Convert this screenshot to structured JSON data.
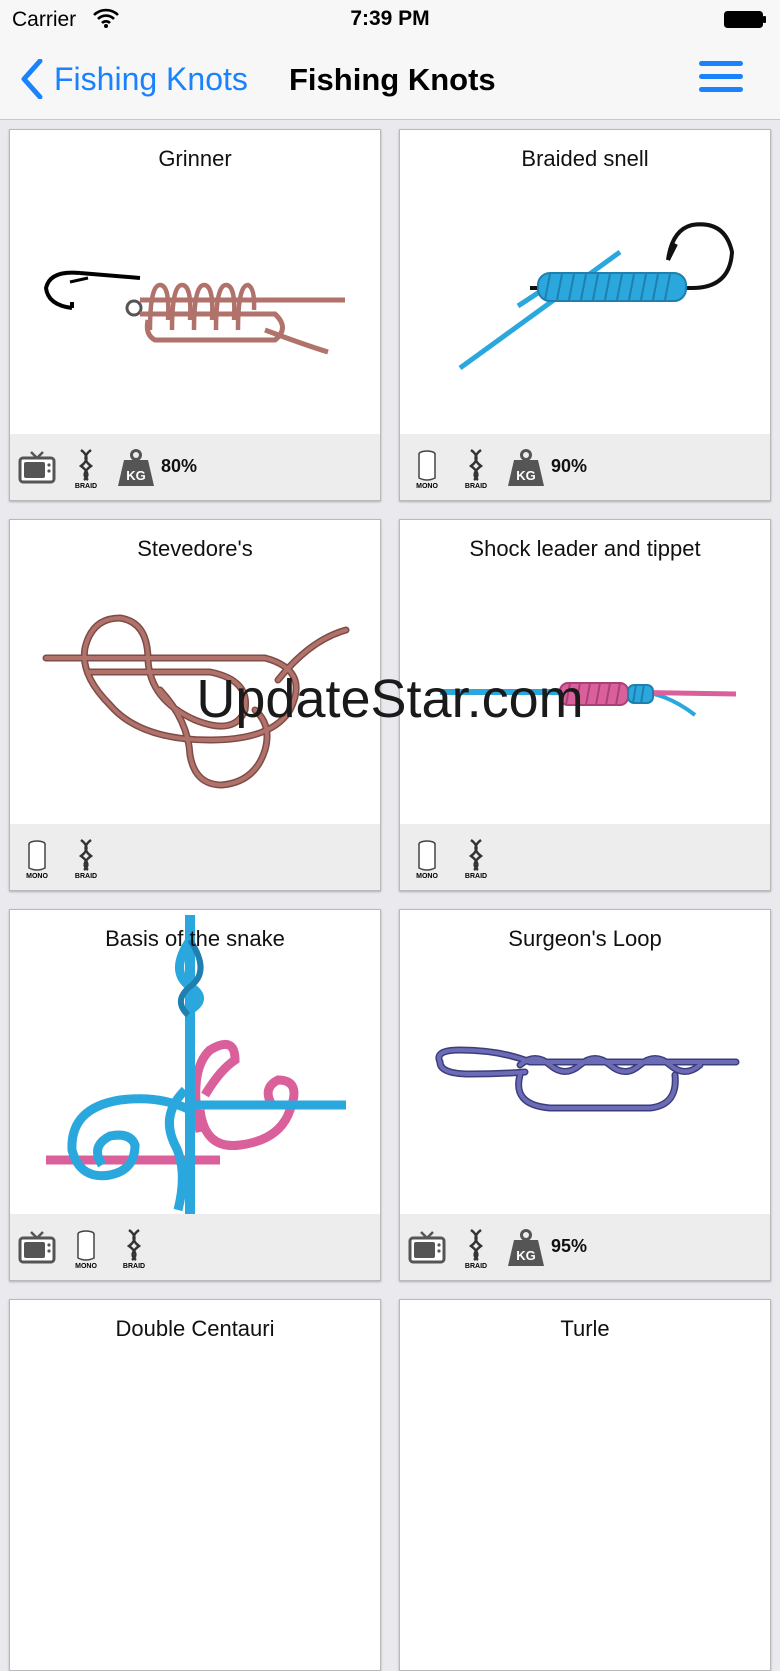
{
  "status": {
    "carrier": "Carrier",
    "time": "7:39 PM"
  },
  "nav": {
    "back_label": "Fishing Knots",
    "title": "Fishing Knots"
  },
  "icons": {
    "mono": "MONO",
    "braid": "BRAID",
    "kg": "KG"
  },
  "knots": [
    {
      "title": "Grinner",
      "strength": "80%",
      "video": true,
      "mono": false,
      "braid": true
    },
    {
      "title": "Braided snell",
      "strength": "90%",
      "video": false,
      "mono": true,
      "braid": true
    },
    {
      "title": "Stevedore's",
      "strength": "",
      "video": false,
      "mono": true,
      "braid": true
    },
    {
      "title": "Shock leader and tippet",
      "strength": "",
      "video": false,
      "mono": true,
      "braid": true
    },
    {
      "title": "Basis of the snake",
      "strength": "",
      "video": true,
      "mono": true,
      "braid": true
    },
    {
      "title": "Surgeon's Loop",
      "strength": "95%",
      "video": true,
      "mono": false,
      "braid": true
    },
    {
      "title": "Double Centauri",
      "strength": "",
      "video": false,
      "mono": false,
      "braid": false
    },
    {
      "title": "Turle",
      "strength": "",
      "video": false,
      "mono": false,
      "braid": false
    }
  ],
  "watermark": "UpdateStar.com",
  "colors": {
    "accent": "#1a82fb",
    "rope_brown": "#b0726b",
    "rope_blue": "#2aa7dc",
    "rope_pink": "#d9609a",
    "rope_purple": "#6b6cb5"
  }
}
